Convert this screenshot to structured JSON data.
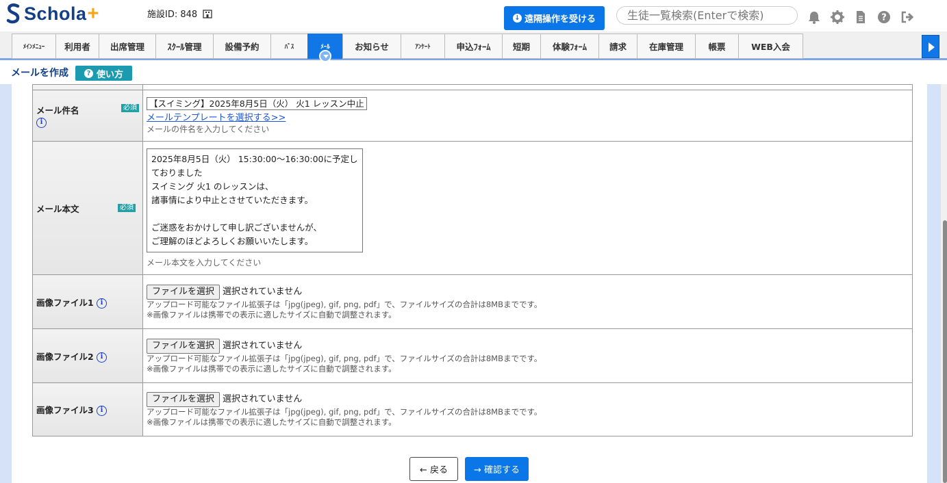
{
  "header": {
    "logo_text": "Schola",
    "logo_plus": "+",
    "facility_label": "施設ID: 848",
    "remote_button": "遠隔操作を受ける",
    "search_placeholder": "生徒一覧検索(Enterで検索)",
    "icons": [
      "bell-icon",
      "gear-icon",
      "document-icon",
      "help-icon",
      "logout-icon"
    ]
  },
  "nav": {
    "tabs": [
      {
        "label": "ﾒｲﾝﾒﾆｭｰ",
        "width": 0
      },
      {
        "label": "利用者"
      },
      {
        "label": "出席管理"
      },
      {
        "label": "ｽｸｰﾙ管理"
      },
      {
        "label": "設備予約"
      },
      {
        "label": "ﾊﾞｽ"
      },
      {
        "label": "ﾒｰﾙ"
      },
      {
        "label": "お知らせ"
      },
      {
        "label": "ｱﾝｹｰﾄ"
      },
      {
        "label": "申込ﾌｫｰﾑ"
      },
      {
        "label": "短期"
      },
      {
        "label": "体験ﾌｫｰﾑ"
      },
      {
        "label": "請求"
      },
      {
        "label": "在庫管理"
      },
      {
        "label": "帳票"
      },
      {
        "label": "WEB入会"
      }
    ],
    "active_tab": "ﾒｰﾙ"
  },
  "page": {
    "title": "メールを作成",
    "help_button": "使い方"
  },
  "form": {
    "required_badge": "必須",
    "subject": {
      "label": "メール件名",
      "value": "【スイミング】2025年8月5日（火） 火1 レッスン中止",
      "template_link": "メールテンプレートを選択する>>",
      "hint": "メールの件名を入力してください"
    },
    "body": {
      "label": "メール本文",
      "value": "2025年8月5日（火） 15:30:00～16:30:00に予定しておりました\nスイミング 火1 のレッスンは、\n諸事情により中止とさせていただきます。\n\nご迷惑をおかけして申し訳ございませんが、\nご理解のほどよろしくお願いいたします。",
      "hint": "メール本文を入力してください"
    },
    "file_button": "ファイルを選択",
    "file_none": "選択されていません",
    "file_hint1": "アップロード可能なファイル拡張子は「jpg(jpeg), gif, png, pdf」で、ファイルサイズの合計は8MBまでです。",
    "file_hint2": "※画像ファイルは携帯での表示に適したサイズに自動で調整されます。",
    "images": [
      {
        "label": "画像ファイル1"
      },
      {
        "label": "画像ファイル2"
      },
      {
        "label": "画像ファイル3"
      }
    ]
  },
  "actions": {
    "back": "← 戻る",
    "confirm": "→ 確認する"
  },
  "colors": {
    "primary": "#0a76e8",
    "brand_navy": "#123f88",
    "brand_orange": "#f2a516",
    "teal": "#1b9ab0"
  }
}
